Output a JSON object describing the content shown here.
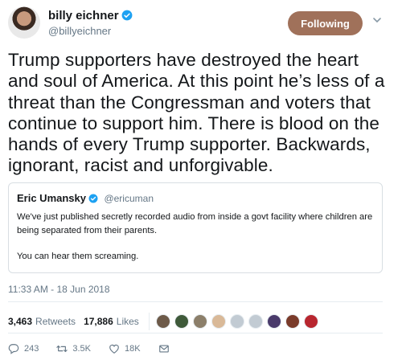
{
  "author": {
    "display_name": "billy eichner",
    "handle": "@billyeichner"
  },
  "follow_button": {
    "label": "Following"
  },
  "tweet": {
    "text": "Trump supporters have destroyed the heart and soul of America. At this point he’s less of a threat than the Congressman and voters that continue to support him. There is blood on the hands of every Trump supporter. Backwards, ignorant, racist and unforgivable."
  },
  "quoted_tweet": {
    "display_name": "Eric Umansky",
    "handle": "@ericuman",
    "line1": "We've just published secretly recorded audio from inside a govt facility where children are being separated from their parents.",
    "line2": "You can hear them screaming."
  },
  "timestamp": "11:33 AM - 18 Jun 2018",
  "stats": {
    "retweets_count": "3,463",
    "retweets_label": "Retweets",
    "likes_count": "17,886",
    "likes_label": "Likes"
  },
  "likers": [
    "#6d5a49",
    "#3f5a3a",
    "#8c7f6a",
    "#d9b998",
    "#c2cbd3",
    "#c2cbd3",
    "#4a3b6b",
    "#7a3b2a",
    "#b8262f"
  ],
  "actions": {
    "replies": "243",
    "retweets": "3.5K",
    "likes": "18K"
  },
  "colors": {
    "follow_button": "#a0715a",
    "verified": "#1da1f2",
    "secondary_text": "#657786"
  }
}
